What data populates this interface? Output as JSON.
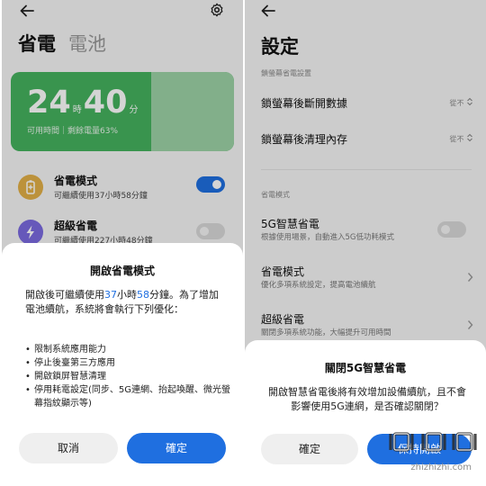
{
  "left": {
    "title": "省電",
    "title_sub": "電池",
    "battery": {
      "hours": "24",
      "hours_unit": "時",
      "minutes": "40",
      "minutes_unit": "分",
      "info": "可用時間｜剩餘電量63%",
      "level_percent": 63,
      "color_main": "#45b25e",
      "color_rest": "#9dd3a7"
    },
    "modes": [
      {
        "title": "省電模式",
        "desc": "可繼續使用37小時58分鐘",
        "toggle_on": true,
        "icon": "battery-saver-icon",
        "icon_color": "#e3b047"
      },
      {
        "title": "超級省電",
        "desc": "可繼續使用227小時48分鐘",
        "toggle_on": false,
        "icon": "lightning-icon",
        "icon_color": "#7b6ae0"
      }
    ],
    "dialog": {
      "title": "開啟省電模式",
      "body_pre": "開啟後可繼續使用",
      "body_hours": "37",
      "body_hours_unit": "小時",
      "body_minutes": "58",
      "body_post": "分鐘。為了增加電池續航，系統將會執行下列優化：",
      "items": [
        "限制系統應用能力",
        "停止後臺第三方應用",
        "開啟鎖屏智慧清理",
        "停用耗電設定(同步、5G連網、抬起喚醒、微光螢幕指紋顯示等)"
      ],
      "cancel_label": "取消",
      "confirm_label": "確定"
    }
  },
  "right": {
    "title": "設定",
    "section1": "鎖螢幕省電設置",
    "rows1": [
      {
        "title": "鎖螢幕後斷開數據",
        "value": "從不"
      },
      {
        "title": "鎖螢幕後清理內存",
        "value": "從不"
      }
    ],
    "section2": "省電模式",
    "rows2": [
      {
        "title": "5G智慧省電",
        "desc": "根據使用場景，自動進入5G低功耗模式",
        "toggle_on": false
      },
      {
        "title": "省電模式",
        "desc": "優化多項系統設定，提高電池續航"
      },
      {
        "title": "超級省電",
        "desc": "關閉多項系統功能，大幅提升可用時間"
      }
    ],
    "dialog": {
      "title": "關閉5G智慧省電",
      "body": "開啟智慧省電後將有效增加設備續航，且不會影響使用5G連網，是否確認關閉？",
      "confirm_label": "確定",
      "other_label": "保持開啟"
    },
    "watermark": {
      "logo_text": "值|值得買",
      "url": "zhizhizhi.com"
    }
  },
  "colors": {
    "accent": "#1f6fe0",
    "green": "#45b25e"
  }
}
